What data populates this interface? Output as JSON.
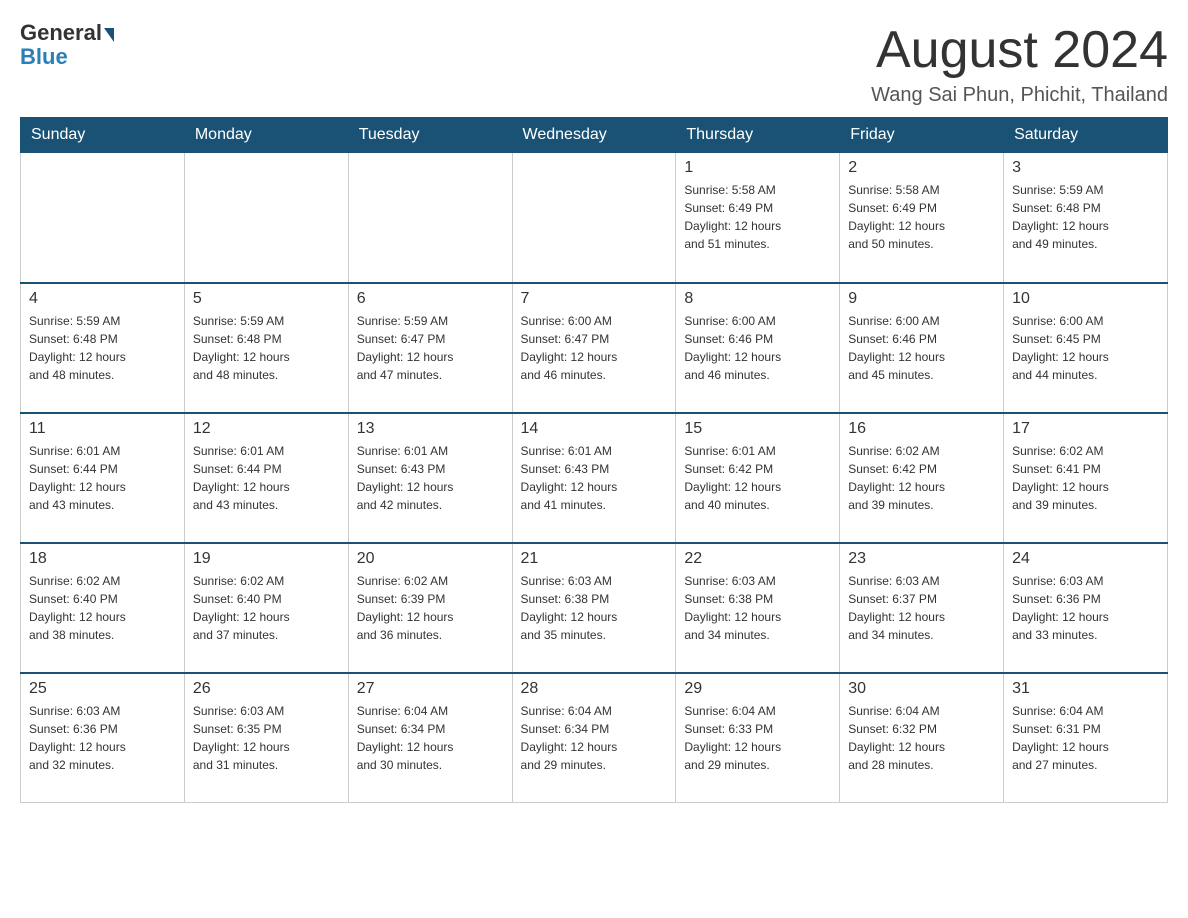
{
  "header": {
    "logo_general": "General",
    "logo_blue": "Blue",
    "month_title": "August 2024",
    "location": "Wang Sai Phun, Phichit, Thailand"
  },
  "calendar": {
    "days_of_week": [
      "Sunday",
      "Monday",
      "Tuesday",
      "Wednesday",
      "Thursday",
      "Friday",
      "Saturday"
    ],
    "weeks": [
      [
        {
          "day": "",
          "info": ""
        },
        {
          "day": "",
          "info": ""
        },
        {
          "day": "",
          "info": ""
        },
        {
          "day": "",
          "info": ""
        },
        {
          "day": "1",
          "info": "Sunrise: 5:58 AM\nSunset: 6:49 PM\nDaylight: 12 hours\nand 51 minutes."
        },
        {
          "day": "2",
          "info": "Sunrise: 5:58 AM\nSunset: 6:49 PM\nDaylight: 12 hours\nand 50 minutes."
        },
        {
          "day": "3",
          "info": "Sunrise: 5:59 AM\nSunset: 6:48 PM\nDaylight: 12 hours\nand 49 minutes."
        }
      ],
      [
        {
          "day": "4",
          "info": "Sunrise: 5:59 AM\nSunset: 6:48 PM\nDaylight: 12 hours\nand 48 minutes."
        },
        {
          "day": "5",
          "info": "Sunrise: 5:59 AM\nSunset: 6:48 PM\nDaylight: 12 hours\nand 48 minutes."
        },
        {
          "day": "6",
          "info": "Sunrise: 5:59 AM\nSunset: 6:47 PM\nDaylight: 12 hours\nand 47 minutes."
        },
        {
          "day": "7",
          "info": "Sunrise: 6:00 AM\nSunset: 6:47 PM\nDaylight: 12 hours\nand 46 minutes."
        },
        {
          "day": "8",
          "info": "Sunrise: 6:00 AM\nSunset: 6:46 PM\nDaylight: 12 hours\nand 46 minutes."
        },
        {
          "day": "9",
          "info": "Sunrise: 6:00 AM\nSunset: 6:46 PM\nDaylight: 12 hours\nand 45 minutes."
        },
        {
          "day": "10",
          "info": "Sunrise: 6:00 AM\nSunset: 6:45 PM\nDaylight: 12 hours\nand 44 minutes."
        }
      ],
      [
        {
          "day": "11",
          "info": "Sunrise: 6:01 AM\nSunset: 6:44 PM\nDaylight: 12 hours\nand 43 minutes."
        },
        {
          "day": "12",
          "info": "Sunrise: 6:01 AM\nSunset: 6:44 PM\nDaylight: 12 hours\nand 43 minutes."
        },
        {
          "day": "13",
          "info": "Sunrise: 6:01 AM\nSunset: 6:43 PM\nDaylight: 12 hours\nand 42 minutes."
        },
        {
          "day": "14",
          "info": "Sunrise: 6:01 AM\nSunset: 6:43 PM\nDaylight: 12 hours\nand 41 minutes."
        },
        {
          "day": "15",
          "info": "Sunrise: 6:01 AM\nSunset: 6:42 PM\nDaylight: 12 hours\nand 40 minutes."
        },
        {
          "day": "16",
          "info": "Sunrise: 6:02 AM\nSunset: 6:42 PM\nDaylight: 12 hours\nand 39 minutes."
        },
        {
          "day": "17",
          "info": "Sunrise: 6:02 AM\nSunset: 6:41 PM\nDaylight: 12 hours\nand 39 minutes."
        }
      ],
      [
        {
          "day": "18",
          "info": "Sunrise: 6:02 AM\nSunset: 6:40 PM\nDaylight: 12 hours\nand 38 minutes."
        },
        {
          "day": "19",
          "info": "Sunrise: 6:02 AM\nSunset: 6:40 PM\nDaylight: 12 hours\nand 37 minutes."
        },
        {
          "day": "20",
          "info": "Sunrise: 6:02 AM\nSunset: 6:39 PM\nDaylight: 12 hours\nand 36 minutes."
        },
        {
          "day": "21",
          "info": "Sunrise: 6:03 AM\nSunset: 6:38 PM\nDaylight: 12 hours\nand 35 minutes."
        },
        {
          "day": "22",
          "info": "Sunrise: 6:03 AM\nSunset: 6:38 PM\nDaylight: 12 hours\nand 34 minutes."
        },
        {
          "day": "23",
          "info": "Sunrise: 6:03 AM\nSunset: 6:37 PM\nDaylight: 12 hours\nand 34 minutes."
        },
        {
          "day": "24",
          "info": "Sunrise: 6:03 AM\nSunset: 6:36 PM\nDaylight: 12 hours\nand 33 minutes."
        }
      ],
      [
        {
          "day": "25",
          "info": "Sunrise: 6:03 AM\nSunset: 6:36 PM\nDaylight: 12 hours\nand 32 minutes."
        },
        {
          "day": "26",
          "info": "Sunrise: 6:03 AM\nSunset: 6:35 PM\nDaylight: 12 hours\nand 31 minutes."
        },
        {
          "day": "27",
          "info": "Sunrise: 6:04 AM\nSunset: 6:34 PM\nDaylight: 12 hours\nand 30 minutes."
        },
        {
          "day": "28",
          "info": "Sunrise: 6:04 AM\nSunset: 6:34 PM\nDaylight: 12 hours\nand 29 minutes."
        },
        {
          "day": "29",
          "info": "Sunrise: 6:04 AM\nSunset: 6:33 PM\nDaylight: 12 hours\nand 29 minutes."
        },
        {
          "day": "30",
          "info": "Sunrise: 6:04 AM\nSunset: 6:32 PM\nDaylight: 12 hours\nand 28 minutes."
        },
        {
          "day": "31",
          "info": "Sunrise: 6:04 AM\nSunset: 6:31 PM\nDaylight: 12 hours\nand 27 minutes."
        }
      ]
    ]
  }
}
